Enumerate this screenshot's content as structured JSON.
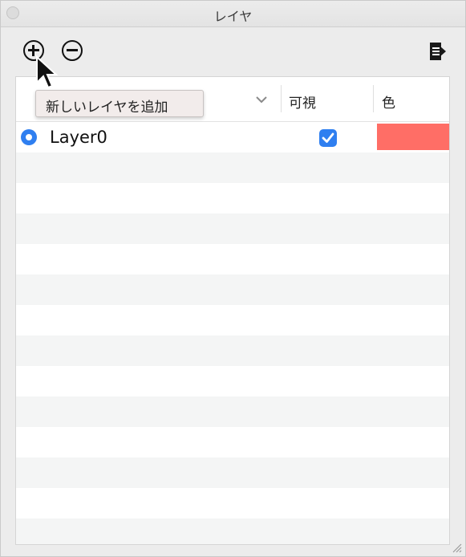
{
  "window": {
    "title": "レイヤ"
  },
  "toolbar": {
    "add_icon": "plus-circle-icon",
    "remove_icon": "minus-circle-icon",
    "export_icon": "export-arrow-icon"
  },
  "tooltip": {
    "text": "新しいレイヤを追加"
  },
  "table": {
    "columns": [
      {
        "label": ""
      },
      {
        "label": "可視"
      },
      {
        "label": "色"
      }
    ],
    "rows": [
      {
        "name": "Layer0",
        "active": true,
        "visible": true,
        "color": "#ff6e66"
      }
    ]
  },
  "colors": {
    "accent": "#2f7ff0",
    "layer_color": "#ff6e66",
    "row_alt": "#f4f5f5"
  }
}
